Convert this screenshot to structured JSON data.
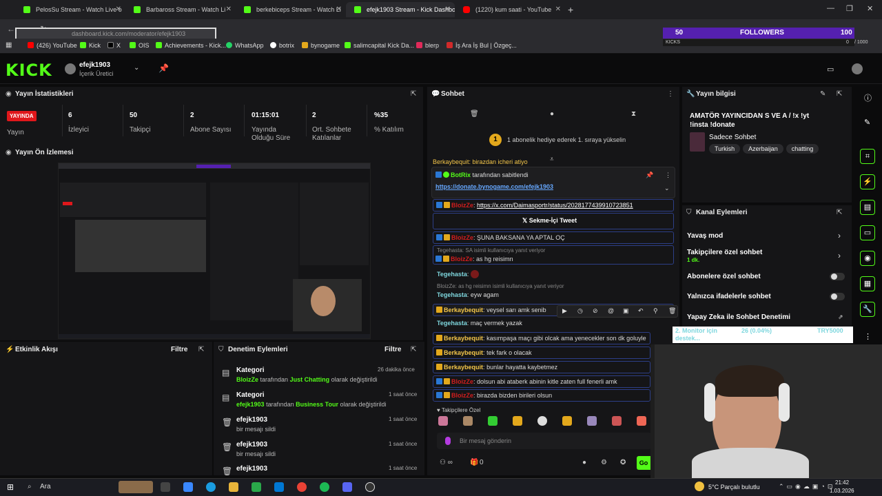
{
  "browser": {
    "tabs": [
      {
        "title": "PelosSu Stream - Watch Live o"
      },
      {
        "title": "Barbaross Stream - Watch Li"
      },
      {
        "title": "berkebiceps Stream - Watch Li"
      },
      {
        "title": "efejk1903 Stream - Kick Dashbo"
      },
      {
        "title": "(1220) kum saati - YouTube"
      }
    ],
    "url": "dashboard.kick.com/moderator/efejk1903",
    "bookmarks": [
      "(426) YouTube",
      "Kick",
      "X",
      "OIS",
      "Achievements - Kick...",
      "WhatsApp",
      "botrix",
      "bynogame",
      "salimcapital Kick Da...",
      "blerp",
      "İş Ara İş Bul | Özgeç..."
    ]
  },
  "overlay": {
    "followers_count": "50",
    "followers_label": "FOLLOWERS",
    "followers_goal": "100",
    "kicks_label": "KICKS",
    "kicks_value": "0",
    "kicks_goal": "/ 1000",
    "monitor_text": "2. Monitor için",
    "monitor_sub": "destek...",
    "monitor_count": "26 (0.04%)",
    "monitor_currency": "TRY5000"
  },
  "header": {
    "logo": "KICK",
    "username": "efejk1903",
    "role": "İçerik Üretici"
  },
  "stats": {
    "title": "Yayın İstatistikleri",
    "live_badge": "YAYINDA",
    "live_label": "Yayın",
    "items": [
      {
        "value": "6",
        "label": "İzleyici"
      },
      {
        "value": "50",
        "label": "Takipçi"
      },
      {
        "value": "2",
        "label": "Abone Sayısı"
      },
      {
        "value": "01:15:01",
        "label": "Yayında Olduğu Süre"
      },
      {
        "value": "2",
        "label": "Ort. Sohbete Katılanlar"
      },
      {
        "value": "%35",
        "label": "% Katılım"
      }
    ]
  },
  "preview": {
    "title": "Yayın Ön İzlemesi"
  },
  "activity": {
    "title": "Etkinlik Akışı",
    "filter": "Filtre"
  },
  "moderation": {
    "title": "Denetim Eylemleri",
    "filter": "Filtre",
    "items": [
      {
        "title": "Kategori",
        "user": "BloizZe",
        "mid": "tarafından",
        "target": "Just Chatting",
        "suffix": "olarak değiştirildi",
        "time": "26 dakika önce"
      },
      {
        "title": "Kategori",
        "user": "efejk1903",
        "mid": "tarafından",
        "target": "Business Tour",
        "suffix": "olarak değiştirildi",
        "time": "1 saat önce"
      },
      {
        "title": "efejk1903",
        "desc": "bir mesajı sildi",
        "time": "1 saat önce"
      },
      {
        "title": "efejk1903",
        "desc": "bir mesajı sildi",
        "time": "1 saat önce"
      },
      {
        "title": "efejk1903",
        "desc": "",
        "time": "1 saat önce"
      }
    ]
  },
  "chat": {
    "title": "Sohbet",
    "gift_banner": "1 abonelik hediye ederek 1. sıraya yükselin",
    "partial_msg": "Berkaybequit: birazdan icheri atiyo",
    "pinned_by": "BotRix",
    "pinned_label": "tarafından sabitlendi",
    "pinned_link": "https://donate.bynogame.com/efejk1903",
    "messages": [
      {
        "user": "BloizZe",
        "sep": ":",
        "text": "https://x.com/Daimasportr/status/2028177439910723851"
      },
      {
        "embed": "Sekme-İçi Tweet"
      },
      {
        "user": "BloizZe",
        "sep": ":",
        "text": "ŞUNA BAKSANA YA APTAL OÇ"
      },
      {
        "reply": "Tegehasta: SA isimli kullanıcıya yanıt veriyor"
      },
      {
        "user": "BloizZe",
        "sep": ":",
        "text": "as hg reisimn"
      },
      {
        "user": "Tegehasta",
        "sep": ":",
        "text": ""
      },
      {
        "reply": "BloizZe: as hg reisimn isimli kullanıcıya yanıt veriyor"
      },
      {
        "user": "Tegehasta",
        "sep": ":",
        "text": "eyw agam"
      },
      {
        "user": "Berkaybequit",
        "sep": ":",
        "text": "veysel sarı amk senib"
      },
      {
        "user": "Tegehasta",
        "sep": ":",
        "text": "maç vermek yazak"
      },
      {
        "user": "Berkaybequit",
        "sep": ":",
        "text": "kasımpaşa maçı gibi olcak ama yenecekler son dk goluyle"
      },
      {
        "user": "Berkaybequit",
        "sep": ":",
        "text": "tek fark o olacak"
      },
      {
        "user": "Berkaybequit",
        "sep": ":",
        "text": "bunlar hayatta kaybetmez"
      },
      {
        "user": "BloizZe",
        "sep": ":",
        "text": "dolsun abi ataberk abinin kitle zaten full fenerli amk"
      },
      {
        "user": "BloizZe",
        "sep": ":",
        "text": "birazda bizden birileri olsun"
      }
    ],
    "followers_only": "Takipçilere Özel",
    "input_placeholder": "Bir mesaj gönderin",
    "count": "0",
    "send": "Go"
  },
  "stream_info": {
    "title": "Yayın bilgisi",
    "stream_title": "AMATÖR YAYINCIDAN S VE A / !x !yt !insta !donate",
    "category": "Sadece Sohbet",
    "tags": [
      "Turkish",
      "Azerbaijan",
      "chatting"
    ]
  },
  "channel_actions": {
    "title": "Kanal Eylemleri",
    "items": [
      {
        "label": "Yavaş mod",
        "sub": "",
        "type": "arrow"
      },
      {
        "label": "Takipçilere özel sohbet",
        "sub": "1 dk.",
        "type": "arrow"
      },
      {
        "label": "Abonelere özel sohbet",
        "sub": "",
        "type": "toggle"
      },
      {
        "label": "Yalnızca ifadelerle sohbet",
        "sub": "",
        "type": "toggle"
      },
      {
        "label": "Yapay Zeka ile Sohbet Denetimi",
        "sub": "",
        "type": "link"
      }
    ]
  },
  "taskbar": {
    "search": "Ara",
    "weather": "5°C  Parçalı bulutlu",
    "time": "21:42",
    "date": "1.03.2026"
  },
  "colors": {
    "accent": "#53fc18",
    "live": "#e0171b",
    "overlay": "#5520b0"
  }
}
